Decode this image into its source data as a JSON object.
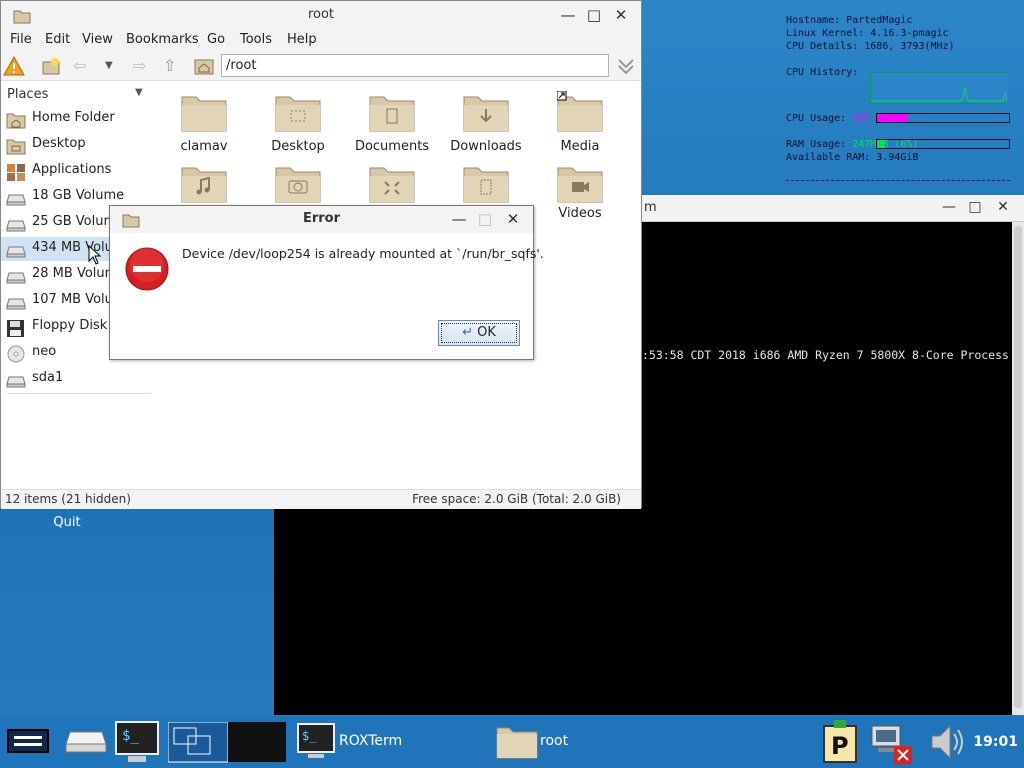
{
  "conky": {
    "hostname": "Hostname: PartedMagic",
    "kernel": "Linux Kernel: 4.16.3-pmagic",
    "cpu_details": "CPU Details:  1686, 3793(MHz)",
    "cpu_history_label": "CPU History:",
    "cpu_usage_label": "CPU Usage:",
    "cpu_usage_value": "23%",
    "cpu_usage_fraction": 0.23,
    "ram_usage_label": "RAM Usage:",
    "ram_usage_value": "247MiB (6%)",
    "ram_usage_fraction": 0.06,
    "available_ram": "Available RAM: 3.94GiB",
    "colors": {
      "cpu": "#ff00ff",
      "ram": "#00e060"
    }
  },
  "terminal": {
    "title_fragment": "m",
    "line": ":53:58 CDT 2018 i686 AMD Ryzen 7 5800X 8-Core Process"
  },
  "desktop": {
    "quit_label": "Quit"
  },
  "file_manager": {
    "title": "root",
    "menu": [
      "File",
      "Edit",
      "View",
      "Bookmarks",
      "Go",
      "Tools",
      "Help"
    ],
    "address": "/root",
    "places_header": "Places",
    "places": [
      {
        "label": "Home Folder",
        "icon": "home-folder-icon"
      },
      {
        "label": "Desktop",
        "icon": "desktop-folder-icon"
      },
      {
        "label": "Applications",
        "icon": "applications-icon"
      },
      {
        "label": "18 GB Volume",
        "icon": "drive-icon"
      },
      {
        "label": "25 GB Volume",
        "icon": "drive-icon"
      },
      {
        "label": "434 MB Volume",
        "icon": "drive-icon"
      },
      {
        "label": "28 MB Volume",
        "icon": "drive-icon"
      },
      {
        "label": "107 MB Volume",
        "icon": "drive-icon"
      },
      {
        "label": "Floppy Disk",
        "icon": "floppy-icon"
      },
      {
        "label": "neo",
        "icon": "cdrom-icon"
      },
      {
        "label": "sda1",
        "icon": "drive-icon"
      }
    ],
    "files": [
      {
        "label": "clamav",
        "icon": "folder-icon"
      },
      {
        "label": "Desktop",
        "icon": "folder-desktop-icon"
      },
      {
        "label": "Documents",
        "icon": "folder-documents-icon"
      },
      {
        "label": "Downloads",
        "icon": "folder-downloads-icon"
      },
      {
        "label": "Media",
        "icon": "folder-link-icon"
      },
      {
        "label": "",
        "icon": "folder-music-icon"
      },
      {
        "label": "",
        "icon": "folder-pictures-icon"
      },
      {
        "label": "",
        "icon": "folder-public-icon"
      },
      {
        "label": "",
        "icon": "folder-templates-icon"
      },
      {
        "label": "Videos",
        "icon": "folder-videos-icon"
      }
    ],
    "status_left": "12 items (21 hidden)",
    "status_right": "Free space: 2.0 GiB (Total: 2.0 GiB)"
  },
  "dialog": {
    "title": "Error",
    "message": "Device /dev/loop254 is already mounted at `/run/br_sqfs'.",
    "ok_label": "OK"
  },
  "taskbar": {
    "roxterm_label": "ROXTerm",
    "root_label": "root",
    "clock": "19:01"
  }
}
